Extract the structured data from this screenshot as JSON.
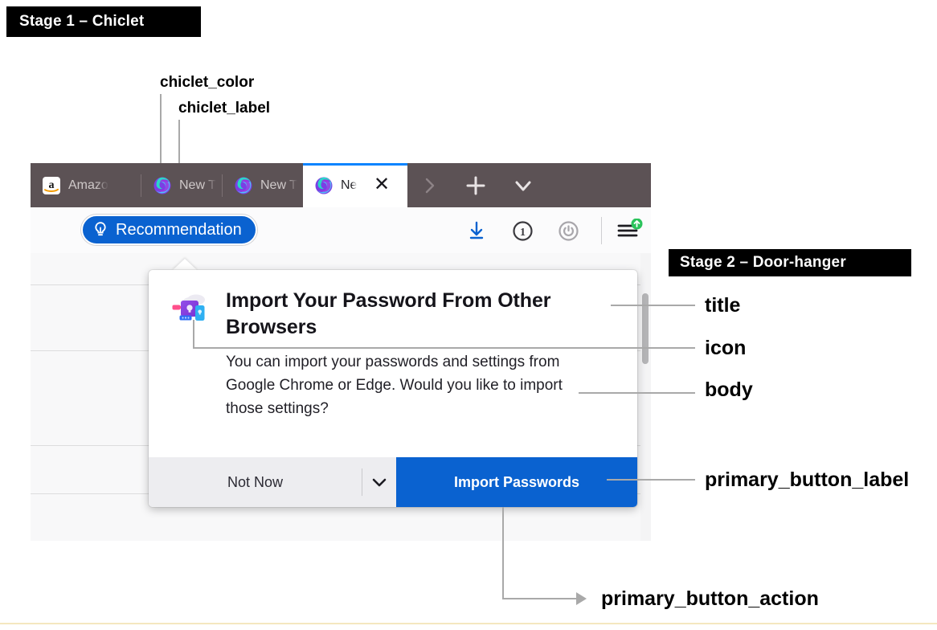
{
  "stages": {
    "stage1_badge": "Stage 1 – Chiclet",
    "stage2_badge": "Stage 2 – Door-hanger"
  },
  "annotations": {
    "chiclet_color": "chiclet_color",
    "chiclet_label": "chiclet_label",
    "title": "title",
    "icon": "icon",
    "body": "body",
    "primary_button_label": "primary_button_label",
    "primary_button_action": "primary_button_action"
  },
  "browser": {
    "tabs": [
      {
        "title": "Amazo",
        "favicon": "amazon-icon",
        "active": false
      },
      {
        "title": "New T",
        "favicon": "firefox-icon",
        "active": false
      },
      {
        "title": "New T",
        "favicon": "firefox-icon",
        "active": false
      },
      {
        "title": "Ne",
        "favicon": "firefox-icon",
        "active": true
      }
    ],
    "tabstrip_buttons": [
      {
        "name": "scroll-tabs-right-icon",
        "glyph": "›"
      },
      {
        "name": "new-tab-icon",
        "glyph": "+"
      },
      {
        "name": "list-all-tabs-icon",
        "glyph": "∨"
      }
    ],
    "active_tab_close": "✕",
    "toolbar_icons": [
      {
        "name": "downloads-icon"
      },
      {
        "name": "password-manager-icon"
      },
      {
        "name": "account-power-icon"
      },
      {
        "name": "app-menu-icon",
        "badge": "update-available-badge"
      }
    ]
  },
  "chiclet": {
    "label": "Recommendation",
    "icon": "lightbulb-icon",
    "color": "#0a62d0"
  },
  "doorhanger": {
    "icon": "import-passwords-illustration",
    "title": "Import Your Password From Other Browsers",
    "body": "You can import your passwords and settings from Google Chrome or Edge. Would you like to import those settings?",
    "secondary_button_label": "Not Now",
    "dropdown_icon": "chevron-down-icon",
    "primary_button_label": "Import Passwords",
    "primary_color": "#0a62d0"
  }
}
